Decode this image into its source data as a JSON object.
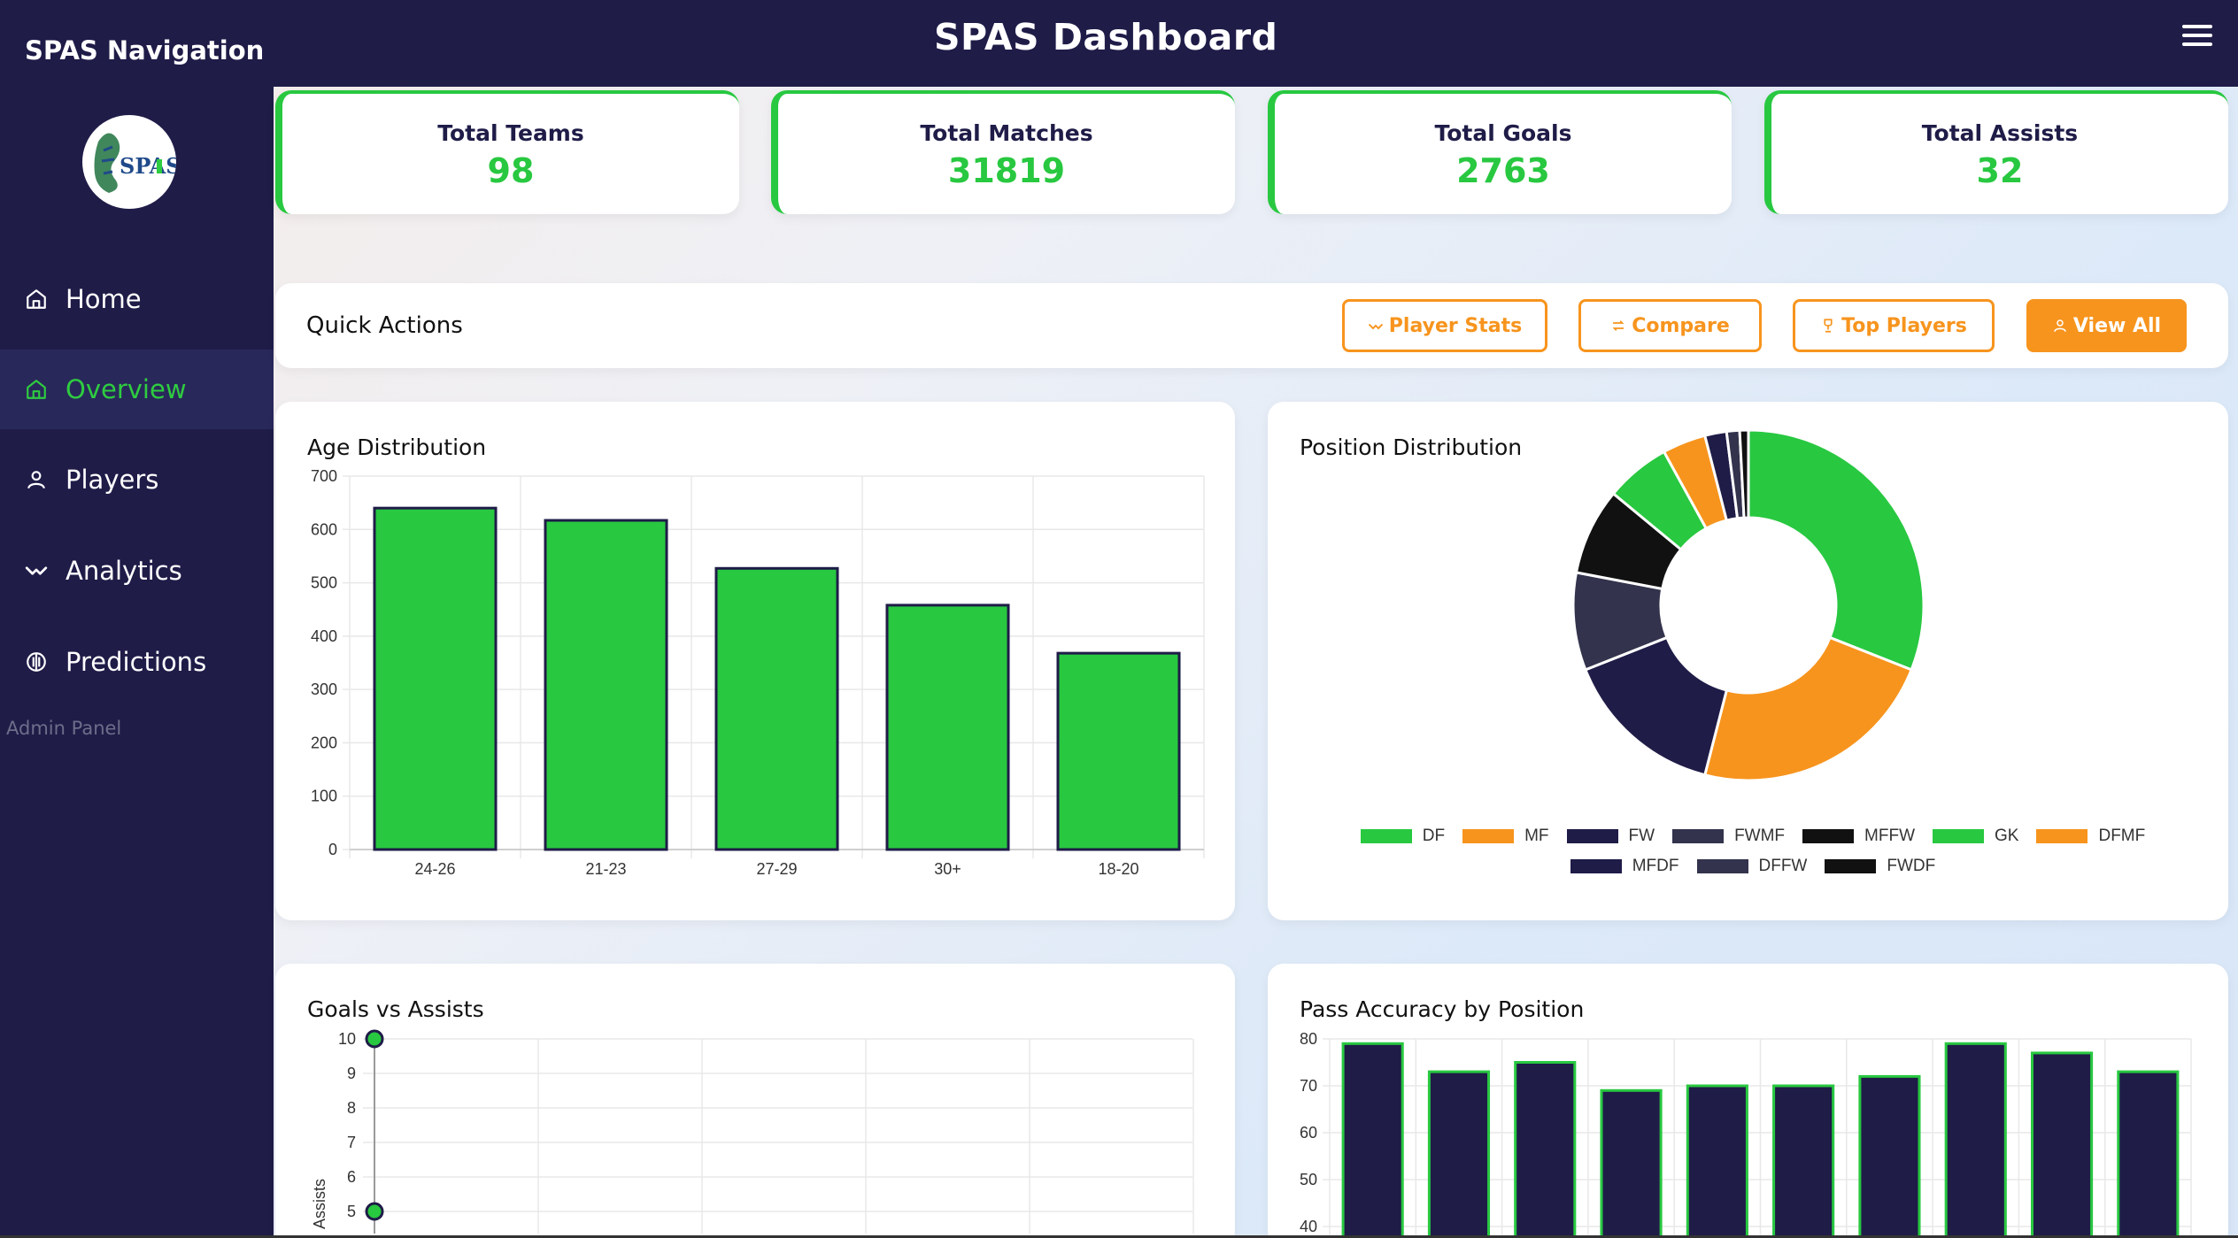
{
  "header": {
    "title": "SPAS Dashboard",
    "menu_icon": "hamburger-icon"
  },
  "sidebar": {
    "title": "SPAS Navigation",
    "logo_text": "SPAS",
    "items": [
      {
        "label": "Home",
        "icon": "home-icon",
        "active": false
      },
      {
        "label": "Overview",
        "icon": "home-icon",
        "active": true
      },
      {
        "label": "Players",
        "icon": "user-icon",
        "active": false
      },
      {
        "label": "Analytics",
        "icon": "activity-icon",
        "active": false
      },
      {
        "label": "Predictions",
        "icon": "predict-icon",
        "active": false
      }
    ],
    "footer": "Admin Panel"
  },
  "stats": [
    {
      "label": "Total Teams",
      "value": "98"
    },
    {
      "label": "Total Matches",
      "value": "31819"
    },
    {
      "label": "Total Goals",
      "value": "2763"
    },
    {
      "label": "Total Assists",
      "value": "32"
    }
  ],
  "quick_actions": {
    "title": "Quick Actions",
    "buttons": [
      {
        "label": "Player Stats",
        "icon": "activity-icon"
      },
      {
        "label": "Compare",
        "icon": "repeat-icon"
      },
      {
        "label": "Top Players",
        "icon": "trophy-icon"
      },
      {
        "label": "View All",
        "icon": "user-icon"
      }
    ]
  },
  "panels": {
    "age": "Age Distribution",
    "position": "Position Distribution",
    "goals_assists": "Goals vs Assists",
    "pass": "Pass Accuracy by Position"
  },
  "colors": {
    "navy": "#1f1c48",
    "green": "#28c840",
    "orange": "#f7941d"
  },
  "chart_data": [
    {
      "type": "bar",
      "title": "Age Distribution",
      "categories": [
        "24-26",
        "21-23",
        "27-29",
        "30+",
        "18-20"
      ],
      "values": [
        640,
        617,
        527,
        458,
        368
      ],
      "ylim": [
        0,
        700
      ],
      "yticks": [
        0,
        100,
        200,
        300,
        400,
        500,
        600,
        700
      ],
      "grid": true
    },
    {
      "type": "pie",
      "title": "Position Distribution",
      "donut": true,
      "labels": [
        "DF",
        "MF",
        "FW",
        "FWMF",
        "MFFW",
        "GK",
        "DFMF",
        "MFDF",
        "DFFW",
        "FWDF"
      ],
      "values": [
        31,
        23,
        15,
        9,
        8,
        6,
        4,
        2,
        1.2,
        0.8
      ],
      "colors": [
        "#28c840",
        "#f7941d",
        "#1f1c48",
        "#33334d",
        "#111111",
        "#28c840",
        "#f7941d",
        "#1f1c48",
        "#33334d",
        "#111111"
      ],
      "legend": "bottom"
    },
    {
      "type": "scatter",
      "title": "Goals vs Assists",
      "ylabel": "Assists",
      "points": [
        {
          "x": 0,
          "y": 10
        },
        {
          "x": 0,
          "y": 5
        }
      ],
      "yticks": [
        5,
        6,
        7,
        8,
        9,
        10
      ],
      "grid": true
    },
    {
      "type": "bar",
      "title": "Pass Accuracy by Position",
      "values": [
        79,
        73,
        75,
        69,
        70,
        70,
        72,
        79,
        77,
        73
      ],
      "yticks": [
        40,
        50,
        60,
        70,
        80
      ],
      "grid": true
    }
  ]
}
